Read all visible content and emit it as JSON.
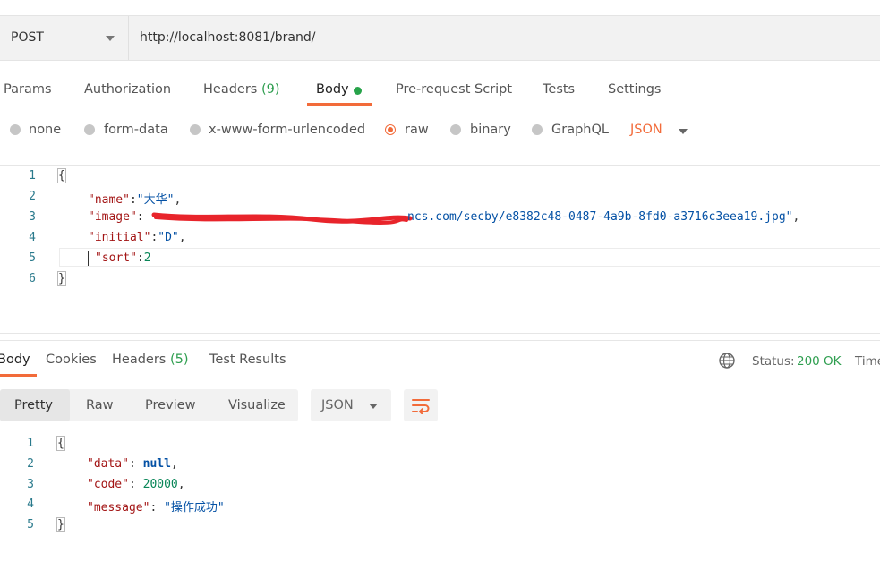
{
  "request": {
    "method": "POST",
    "url": "http://localhost:8081/brand/"
  },
  "request_tabs": [
    {
      "label": "Params"
    },
    {
      "label": "Authorization"
    },
    {
      "label": "Headers",
      "count": "(9)"
    },
    {
      "label": "Body"
    },
    {
      "label": "Pre-request Script"
    },
    {
      "label": "Tests"
    },
    {
      "label": "Settings"
    }
  ],
  "body_types": [
    "none",
    "form-data",
    "x-www-form-urlencoded",
    "raw",
    "binary",
    "GraphQL"
  ],
  "body_format": "JSON",
  "request_body": {
    "line_numbers": [
      "1",
      "2",
      "3",
      "4",
      "5",
      "6"
    ],
    "open_brace": "{",
    "close_brace": "}",
    "name_key": "\"name\"",
    "name_value": "\"大华\"",
    "image_key": "\"image\"",
    "image_value_visible": "ncs.com/secby/e8382c48-0487-4a9b-8fd0-a3716c3eea19.jpg\"",
    "initial_key": "\"initial\"",
    "initial_value": "\"D\"",
    "sort_key": "\"sort\"",
    "sort_value": "2"
  },
  "response_tabs": [
    {
      "label": "Body"
    },
    {
      "label": "Cookies"
    },
    {
      "label": "Headers",
      "count": "(5)"
    },
    {
      "label": "Test Results"
    }
  ],
  "status": {
    "label": "Status:",
    "value": "200 OK",
    "time_label": "Time"
  },
  "view_modes": [
    "Pretty",
    "Raw",
    "Preview",
    "Visualize"
  ],
  "response_format": "JSON",
  "response_body": {
    "line_numbers": [
      "1",
      "2",
      "3",
      "4",
      "5"
    ],
    "open_brace": "{",
    "close_brace": "}",
    "data_key": "\"data\"",
    "data_value": "null",
    "code_key": "\"code\"",
    "code_value": "20000",
    "message_key": "\"message\"",
    "message_value": "\"操作成功\""
  },
  "colors": {
    "accent": "#f26b3a",
    "success": "#2e9e4f",
    "body_dot": "#27a34a"
  }
}
